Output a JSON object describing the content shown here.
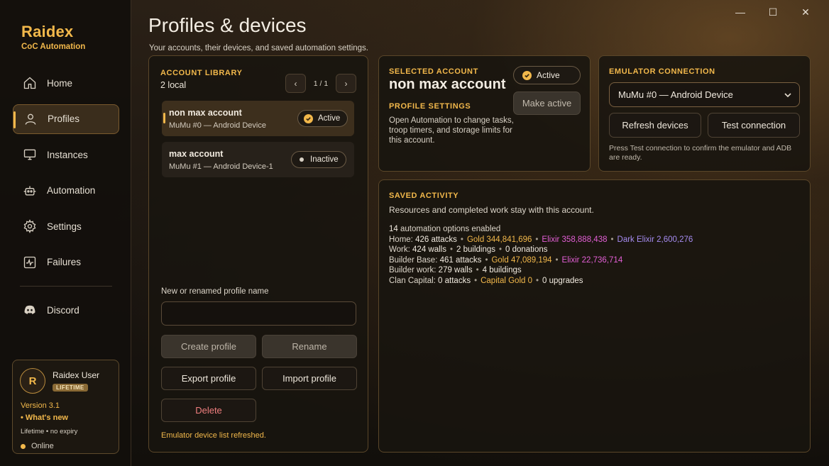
{
  "brand": {
    "name": "Raidex",
    "subtitle": "CoC Automation"
  },
  "window_controls": {
    "minimize": "—",
    "maximize": "☐",
    "close": "✕"
  },
  "nav": [
    {
      "label": "Home",
      "icon": "home-icon"
    },
    {
      "label": "Profiles",
      "icon": "user-icon",
      "active": true
    },
    {
      "label": "Instances",
      "icon": "monitor-icon"
    },
    {
      "label": "Automation",
      "icon": "robot-icon"
    },
    {
      "label": "Settings",
      "icon": "gear-icon"
    },
    {
      "label": "Failures",
      "icon": "pulse-icon"
    }
  ],
  "discord": {
    "label": "Discord",
    "icon": "discord-icon"
  },
  "user": {
    "avatar_letter": "R",
    "name": "Raidex User",
    "badge": "LIFETIME",
    "version": "Version 3.1",
    "whats_new": "What's new",
    "license": "Lifetime • no expiry",
    "status": "Online"
  },
  "header": {
    "title": "Profiles & devices",
    "subtitle": "Your accounts, their devices, and saved automation settings."
  },
  "library": {
    "title": "ACCOUNT LIBRARY",
    "count": "2 local",
    "pager": {
      "prev": "‹",
      "text": "1 / 1",
      "next": "›"
    },
    "accounts": [
      {
        "name": "non max account",
        "device": "MuMu #0 — Android Device",
        "status": "Active"
      },
      {
        "name": "max account",
        "device": "MuMu #1 — Android Device-1",
        "status": "Inactive"
      }
    ],
    "field_label": "New or renamed profile name",
    "field_value": "",
    "create": "Create profile",
    "rename": "Rename",
    "export": "Export profile",
    "import": "Import profile",
    "delete": "Delete",
    "status_message": "Emulator device list refreshed."
  },
  "selected": {
    "label": "SELECTED ACCOUNT",
    "name": "non max account",
    "status": "Active",
    "make_active": "Make active",
    "settings_label": "PROFILE SETTINGS",
    "settings_desc": "Open Automation to change tasks, troop timers, and storage limits for this account."
  },
  "emulator": {
    "label": "EMULATOR CONNECTION",
    "selected_device": "MuMu #0 — Android Device",
    "refresh": "Refresh devices",
    "test": "Test connection",
    "hint": "Press Test connection to confirm the emulator and ADB are ready."
  },
  "activity": {
    "label": "SAVED ACTIVITY",
    "desc": "Resources and completed work stay with this account.",
    "options_count": "14",
    "options_text": "automation options enabled",
    "home": {
      "label": "Home:",
      "attacks": "426 attacks",
      "gold": "Gold 344,841,696",
      "elixir": "Elixir 358,888,438",
      "dark": "Dark Elixir 2,600,276"
    },
    "work": {
      "label": "Work:",
      "walls": "424 walls",
      "buildings": "2 buildings",
      "donations": "0 donations"
    },
    "builder_base": {
      "label": "Builder Base:",
      "attacks": "461 attacks",
      "gold": "Gold 47,089,194",
      "elixir": "Elixir 22,736,714"
    },
    "builder_work": {
      "label": "Builder work:",
      "walls": "279 walls",
      "buildings": "4 buildings"
    },
    "clan_capital": {
      "label": "Clan Capital:",
      "attacks": "0 attacks",
      "gold": "Capital Gold 0",
      "upgrades": "0 upgrades"
    },
    "separator": "•"
  },
  "colors": {
    "accent": "#f2b84b",
    "elixir": "#e35fd6",
    "dark_elixir": "#a58bf0",
    "danger": "#f07f7f"
  }
}
